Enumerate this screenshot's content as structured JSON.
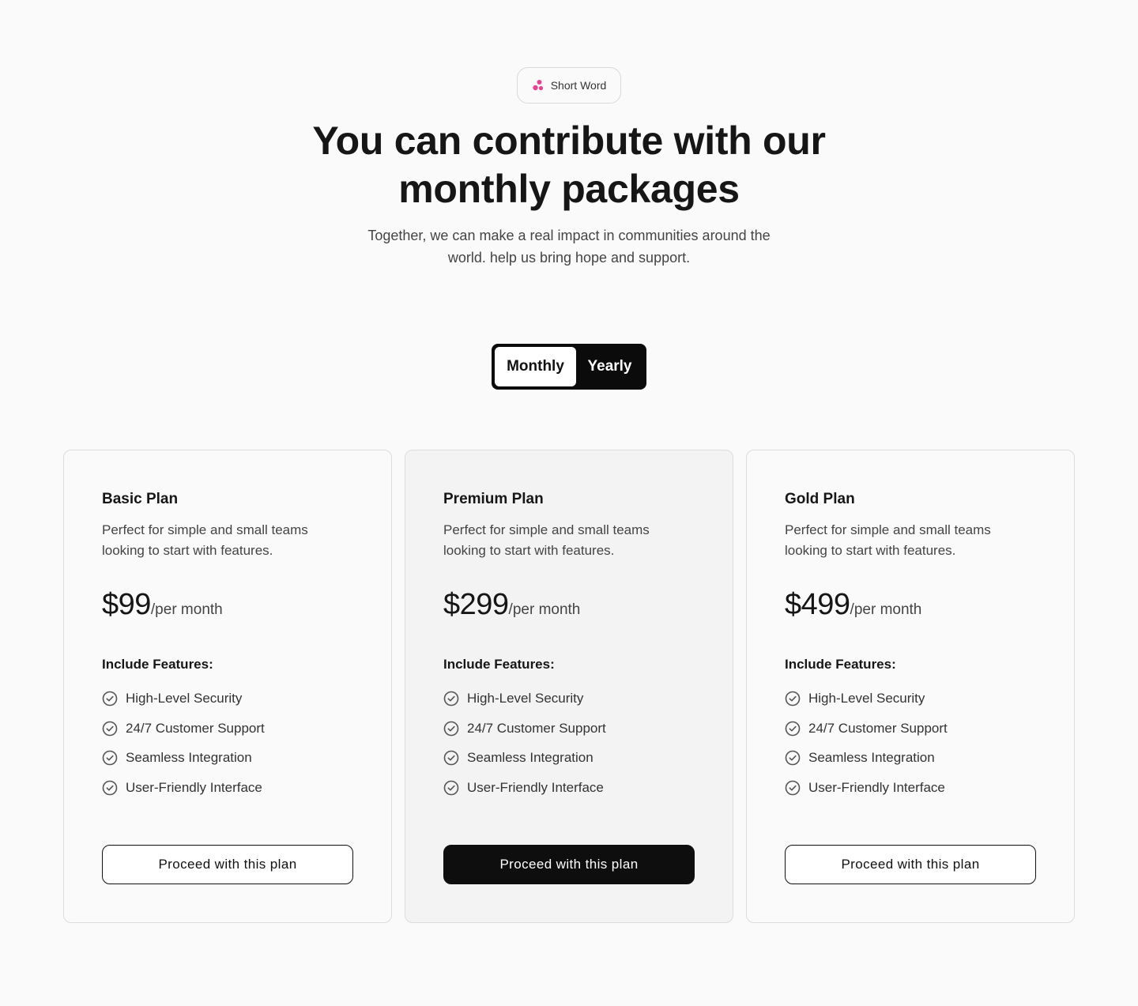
{
  "badge": {
    "label": "Short Word",
    "icon": "molecule-dots-icon",
    "icon_color": "#e84393"
  },
  "hero": {
    "title_line1": "You can contribute with our",
    "title_line2": "monthly packages",
    "subtitle": "Together, we can make a real impact in communities around the world. help us bring hope and support."
  },
  "billing_toggle": {
    "options": [
      "Monthly",
      "Yearly"
    ],
    "selected": "Monthly"
  },
  "plans": [
    {
      "name": "Basic Plan",
      "description": "Perfect for simple and small teams looking to start with features.",
      "price": "$99",
      "period": "/per month",
      "features_heading": "Include Features:",
      "features": [
        "High-Level Security",
        "24/7 Customer Support",
        "Seamless Integration",
        "User-Friendly Interface"
      ],
      "cta": "Proceed with this plan"
    },
    {
      "name": "Premium Plan",
      "description": "Perfect for simple and small teams looking to start with features.",
      "price": "$299",
      "period": "/per month",
      "features_heading": "Include Features:",
      "features": [
        "High-Level Security",
        "24/7 Customer Support",
        "Seamless Integration",
        "User-Friendly Interface"
      ],
      "cta": "Proceed with this plan"
    },
    {
      "name": "Gold Plan",
      "description": "Perfect for simple and small teams looking to start with features.",
      "price": "$499",
      "period": "/per month",
      "features_heading": "Include Features:",
      "features": [
        "High-Level Security",
        "24/7 Customer Support",
        "Seamless Integration",
        "User-Friendly Interface"
      ],
      "cta": "Proceed with this plan"
    }
  ],
  "colors": {
    "background": "#fafafa",
    "featured_card": "#f3f3f3",
    "primary_dark": "#0e0e0e",
    "accent_pink": "#e84393"
  }
}
